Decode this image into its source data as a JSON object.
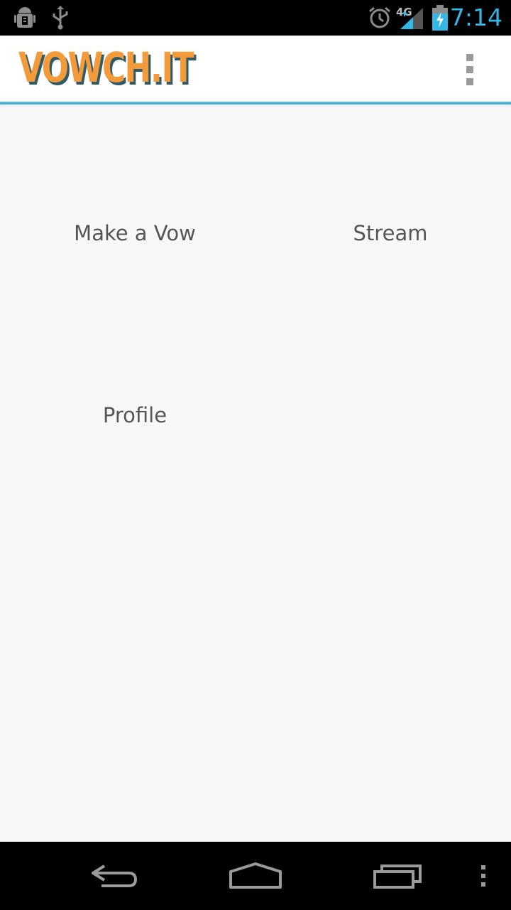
{
  "status_bar": {
    "time": "7:14",
    "network_label": "4G",
    "icons": [
      "android-debug-icon",
      "usb-icon",
      "alarm-icon",
      "signal-icon",
      "battery-charging-icon"
    ],
    "time_color": "#33b5e5"
  },
  "action_bar": {
    "logo_text": "VOWCH.IT",
    "logo_colors": {
      "fill": "#f39a3a",
      "shadow": "#2f5b66"
    },
    "accent_line_color": "#4fb7da",
    "overflow_icon": "more-vertical-icon"
  },
  "menu": {
    "items": [
      {
        "label": "Make a Vow"
      },
      {
        "label": "Stream"
      },
      {
        "label": "Profile"
      }
    ]
  },
  "nav_bar": {
    "icons": [
      "back-icon",
      "home-icon",
      "recent-apps-icon",
      "overflow-menu-icon"
    ]
  }
}
